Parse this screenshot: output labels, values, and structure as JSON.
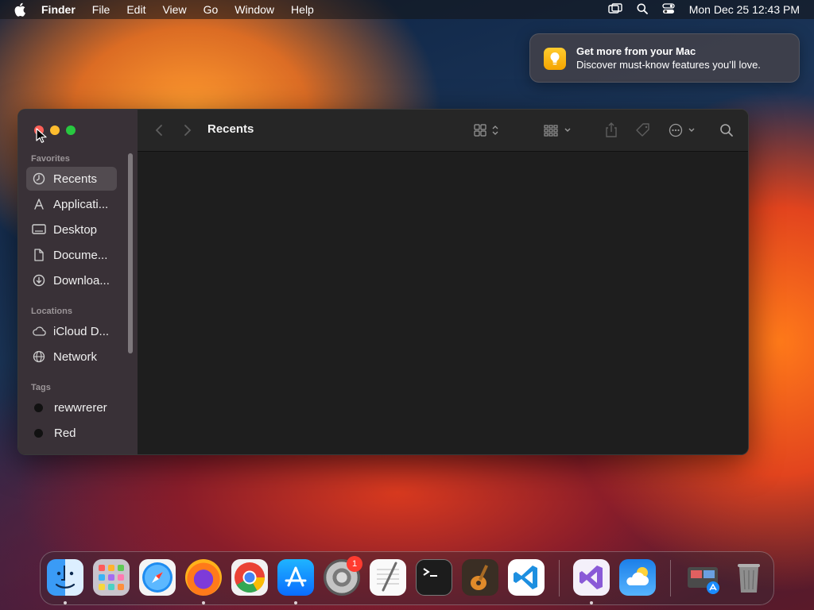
{
  "menubar": {
    "app_name": "Finder",
    "items": [
      "File",
      "Edit",
      "View",
      "Go",
      "Window",
      "Help"
    ],
    "clock": "Mon Dec 25  12:43 PM"
  },
  "notification": {
    "title": "Get more from your Mac",
    "body": "Discover must-know features you’ll love."
  },
  "finder": {
    "window_title": "Recents",
    "sidebar": {
      "favorites_label": "Favorites",
      "favorites": [
        {
          "label": "Recents",
          "icon": "clock-icon",
          "selected": true
        },
        {
          "label": "Applicati...",
          "icon": "applications-icon"
        },
        {
          "label": "Desktop",
          "icon": "desktop-icon"
        },
        {
          "label": "Docume...",
          "icon": "document-icon"
        },
        {
          "label": "Downloa...",
          "icon": "download-icon"
        }
      ],
      "locations_label": "Locations",
      "locations": [
        {
          "label": "iCloud D...",
          "icon": "cloud-icon"
        },
        {
          "label": "Network",
          "icon": "globe-icon"
        }
      ],
      "tags_label": "Tags",
      "tags": [
        {
          "label": "rewwrerer",
          "color": "#111111"
        },
        {
          "label": "Red",
          "color": "#111111"
        }
      ]
    }
  },
  "dock": {
    "apps": [
      "Finder",
      "Launchpad",
      "Safari",
      "Firefox",
      "Chrome",
      "App Store",
      "System Settings",
      "TextEdit",
      "Terminal",
      "GarageBand",
      "Visual Studio Code",
      "Visual Studio",
      "Weather",
      "Downloads",
      "Trash"
    ],
    "settings_badge": "1"
  },
  "colors": {
    "close": "#ff5f57",
    "minimize": "#febc2e",
    "maximize": "#28c840",
    "sidebar_bg": "#3a3238",
    "content_bg": "#1e1e1e"
  }
}
